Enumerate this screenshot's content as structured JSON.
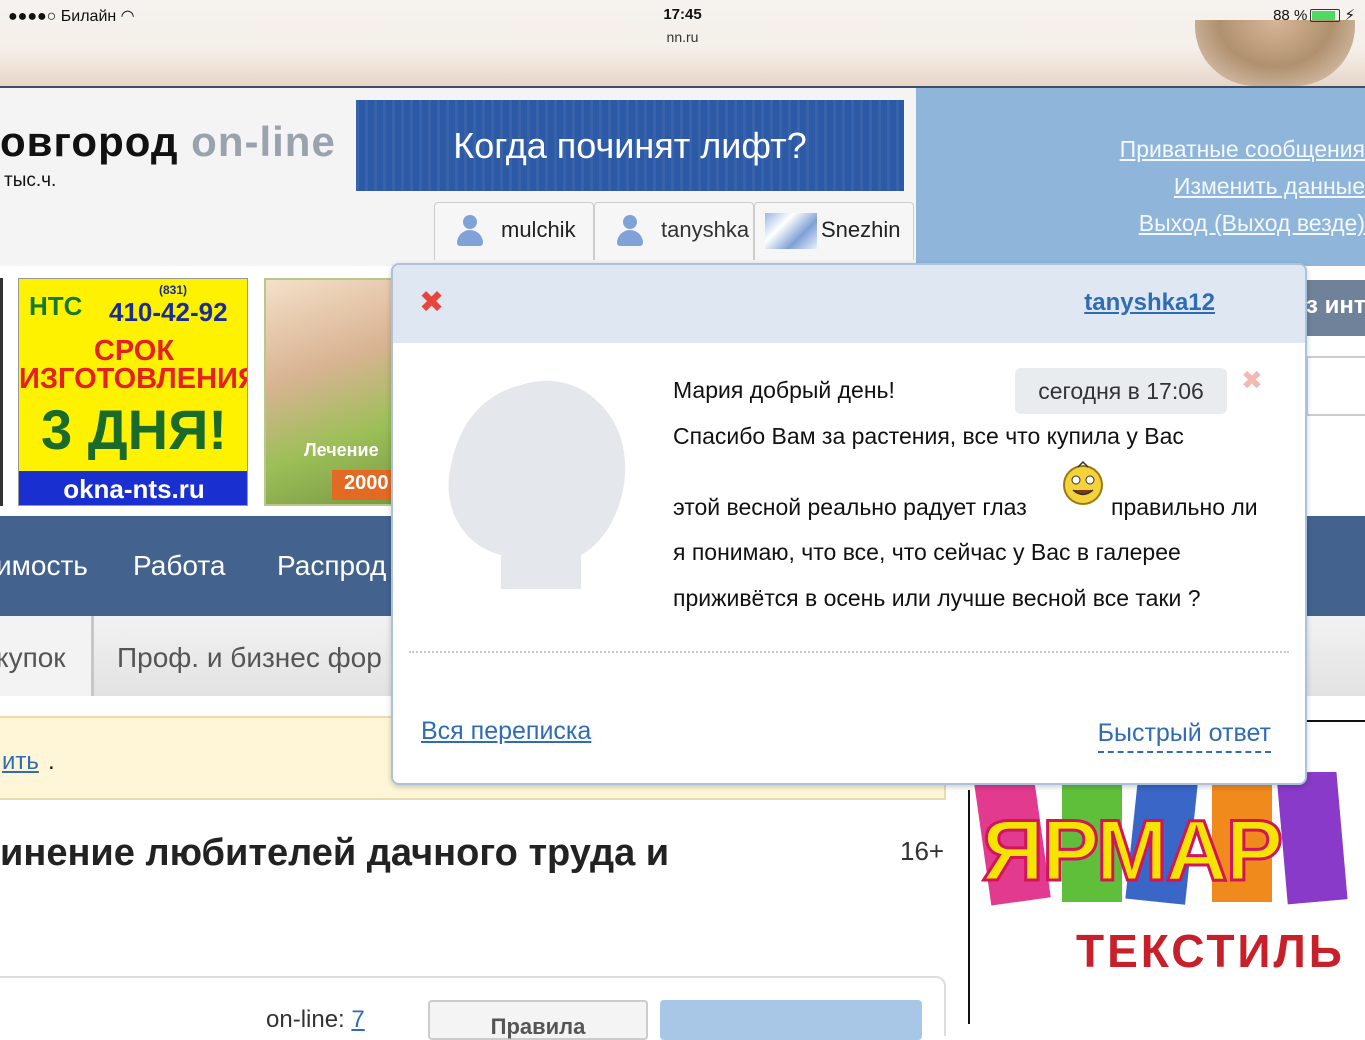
{
  "status_bar": {
    "carrier": "●●●●○ Билайн",
    "time": "17:45",
    "url": "nn.ru",
    "battery": "88 %"
  },
  "header": {
    "city_title": "овгород",
    "city_suffix": "on-line",
    "visitors": "тыс.ч.",
    "banner_text": "Когда починят лифт?",
    "chat_tabs": [
      "mulchik",
      "tanyshka",
      "Snezhin"
    ],
    "account_links": [
      "Приватные сообщения",
      "Изменить данные",
      "Выход (Выход везде)"
    ]
  },
  "ads": {
    "nts_brand": "НТС",
    "nts_phone_code": "(831)",
    "nts_phone": "410-42-92",
    "nts_line1": "СРОК",
    "nts_line2": "ИЗГОТОВЛЕНИЯ",
    "nts_line3": "3 ДНЯ!",
    "nts_site": "okna-nts.ru",
    "clinic_label": "Лечение",
    "clinic_price": "2000"
  },
  "nav": {
    "items": [
      "имость",
      "Работа",
      "Распрод"
    ]
  },
  "subnav": {
    "items": [
      "купок",
      "Проф. и бизнес фор"
    ]
  },
  "notice": {
    "link": "ить",
    "tail": "."
  },
  "main": {
    "headline": "инение любителей дачного труда и",
    "age_rating": "16+",
    "online_label": "on-line:",
    "online_count": "7",
    "button_label": "Правила"
  },
  "right_side": {
    "tab_label": "з инт",
    "ad_title": "ЯРМАР",
    "ad_subtitle": "ТЕКСТИЛЬ"
  },
  "popup": {
    "sender": "tanyshka12",
    "timestamp": "сегодня в 17:06",
    "message_lines": [
      "Мария добрый день!",
      "Спасибо Вам за растения, все что купила у Вас",
      "этой весной реально радует глаз",
      "правильно ли",
      "я понимаю, что все, что сейчас у Вас в галерее",
      "приживётся в осень или лучше весной все таки ?"
    ],
    "all_messages_link": "Вся переписка",
    "quick_reply_link": "Быстрый ответ"
  },
  "colors": {
    "link": "#2f6cb5",
    "nav_bg": "#43628e",
    "right_panel": "#8fb5da",
    "close": "#e8453c"
  }
}
